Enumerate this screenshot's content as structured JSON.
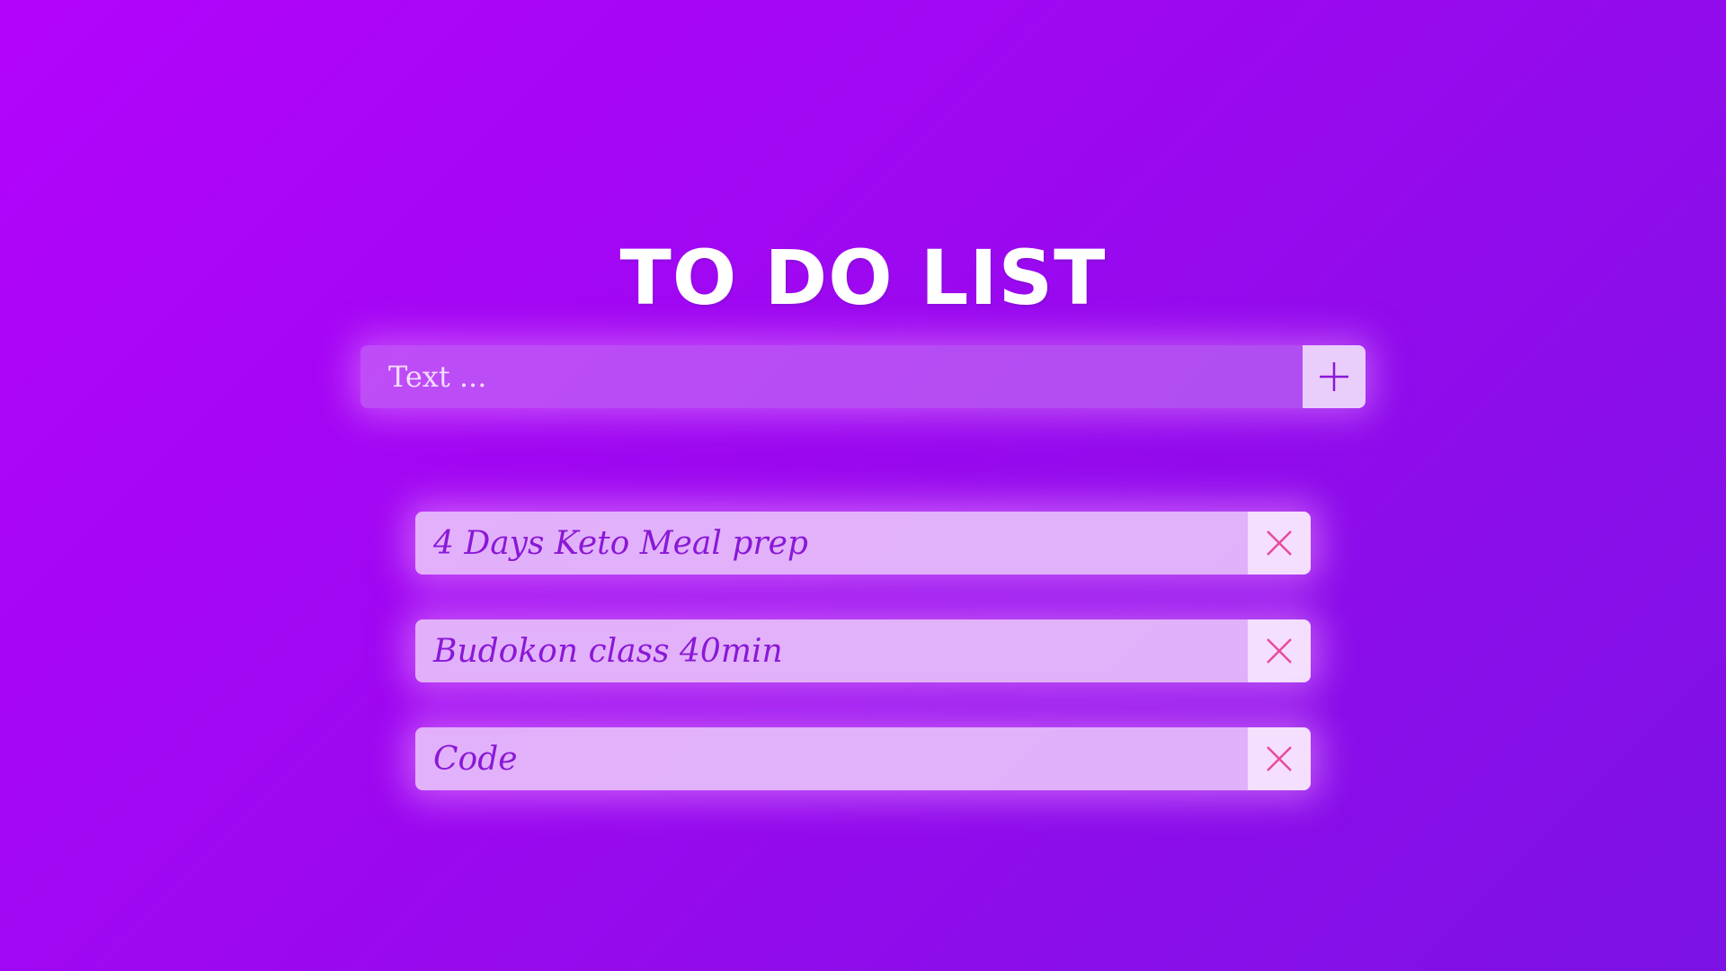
{
  "app": {
    "title": "TO DO LIST"
  },
  "new_task": {
    "placeholder": "Text ...",
    "value": "",
    "add_icon": "plus-icon"
  },
  "tasks": [
    {
      "text": "4 Days Keto Meal prep",
      "delete_icon": "close-icon"
    },
    {
      "text": "Budokon class 40min",
      "delete_icon": "close-icon"
    },
    {
      "text": "Code",
      "delete_icon": "close-icon"
    }
  ],
  "colors": {
    "background_start": "#b304fb",
    "background_end": "#7c12e4",
    "accent": "#8a18d6",
    "delete": "#e84a9a"
  }
}
